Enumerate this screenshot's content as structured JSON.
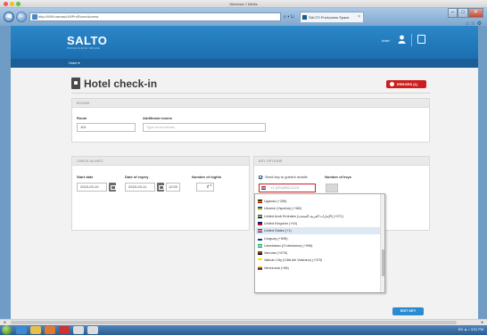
{
  "window": {
    "title": "Windows 7 64bits"
  },
  "browser": {
    "address": "http://WIN-samacL69ProRoomAccess",
    "tab_title": "SALTO ProAccess Space",
    "tab_close": "×",
    "addr_ctrls": "⌕ ▾ ↻",
    "back_glyph": "◀",
    "forward_glyph": "▶",
    "right_icons": "⌂ ☆ ⚙",
    "win_minimize": "–",
    "win_maximize": "□",
    "win_close": "✕"
  },
  "app": {
    "logo": "SALTO",
    "logo_sub": "PROACCESS SPACE",
    "user": "hotel",
    "menu_label": "Hotel ▾"
  },
  "page": {
    "title": "Hotel check-in",
    "errors_label": "ERRORS (1)"
  },
  "rooms": {
    "section": "ROOMS",
    "room_label": "Room",
    "room_value": "101",
    "additional_label": "Additional rooms",
    "additional_placeholder": "Type room names"
  },
  "checkin": {
    "section": "CHECK-IN INFO",
    "start_label": "Start date",
    "start_value": "2015-03-10",
    "expiry_label": "Date of expiry",
    "expiry_value": "2015-03-11",
    "expiry_time": "12:00",
    "nights_label": "Number of nights",
    "nights_value": "1"
  },
  "key": {
    "section": "KEY OPTIONS",
    "send_label": "Send key to guest's mobile",
    "send_checked": true,
    "keys_label": "Number of keys",
    "phone_placeholder": "+1 (201)555-0123",
    "stepper_arrows": "▲▼"
  },
  "countries": [
    {
      "name": "Uganda (+256)",
      "colors": [
        "#000",
        "#fcdc04",
        "#d90000"
      ]
    },
    {
      "name": "Ukraine (Україна) (+380)",
      "colors": [
        "#0057b7",
        "#ffd700"
      ]
    },
    {
      "name": "United Arab Emirates (الإمارات العربية المتحدة) (+971)",
      "colors": [
        "#00732f",
        "#fff",
        "#000"
      ]
    },
    {
      "name": "United Kingdom (+44)",
      "colors": [
        "#012169",
        "#c8102e"
      ]
    },
    {
      "name": "United States (+1)",
      "colors": [
        "#b22234",
        "#fff",
        "#3c3b6e"
      ],
      "selected": true
    },
    {
      "name": "Uruguay (+598)",
      "colors": [
        "#fff",
        "#0038a8"
      ]
    },
    {
      "name": "Uzbekistan (Oʻzbekiston) (+998)",
      "colors": [
        "#1eb53a",
        "#fff",
        "#0099b5"
      ]
    },
    {
      "name": "Vanuatu (+678)",
      "colors": [
        "#d21034",
        "#009543",
        "#000"
      ]
    },
    {
      "name": "Vatican City (Città del Vaticano) (+379)",
      "colors": [
        "#ffe000",
        "#fff"
      ]
    },
    {
      "name": "Venezuela (+58)",
      "colors": [
        "#ffcc00",
        "#00247d",
        "#cf142b"
      ]
    }
  ],
  "actions": {
    "edit_key": "EDIT KEY"
  },
  "scrollbar": {
    "left": "◂",
    "right": "▸"
  },
  "taskbar": {
    "tray": "EN ▲ ♪ 3:31 PM"
  }
}
